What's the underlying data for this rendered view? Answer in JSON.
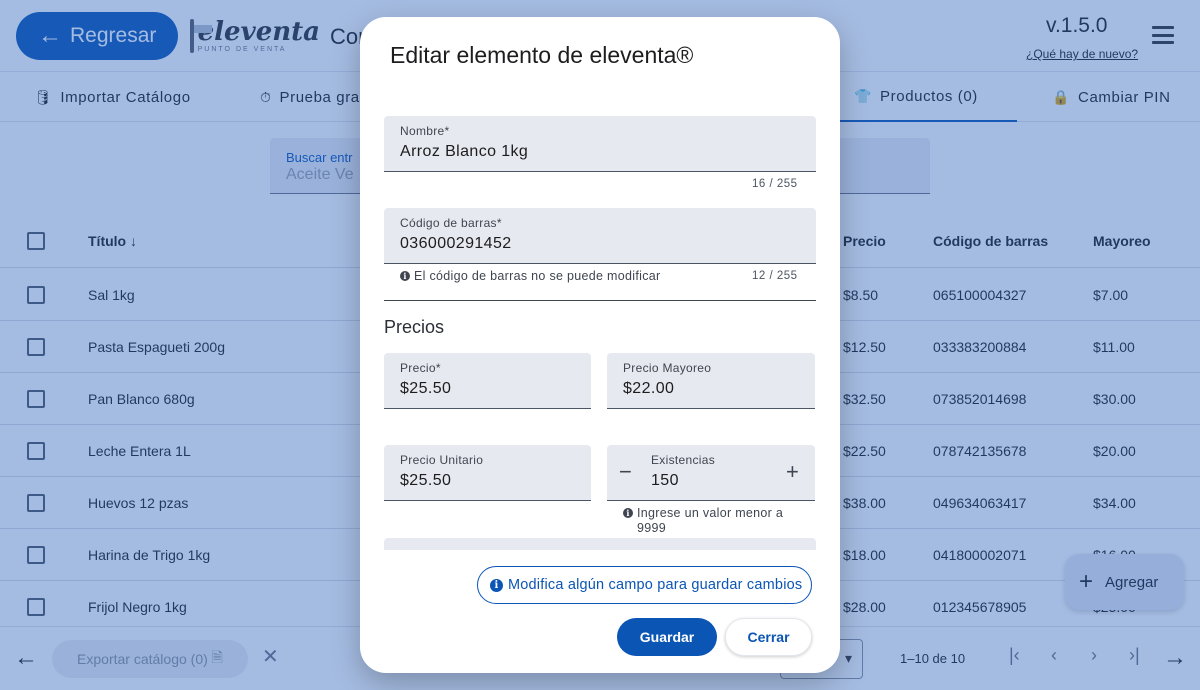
{
  "header": {
    "back_label": "Regresar",
    "logo_text": "eleventa",
    "logo_sub": "PUNTO DE VENTA",
    "title_partial": "Con",
    "version": "v.1.5.0",
    "whats_new": "¿Qué hay de nuevo?"
  },
  "tabs": [
    {
      "label": "Importar Catálogo",
      "icon": "database-icon"
    },
    {
      "label": "Prueba gra",
      "icon": "stopwatch-icon"
    },
    {
      "label": "Productos (0)",
      "icon": "shirt-icon"
    },
    {
      "label": "Cambiar PIN",
      "icon": "lock-icon"
    }
  ],
  "search": {
    "label": "Buscar entr",
    "placeholder": "Aceite Ve"
  },
  "table": {
    "columns": {
      "title": "Título",
      "price": "Precio",
      "barcode": "Código de barras",
      "wholesale": "Mayoreo"
    },
    "rows": [
      {
        "title": "Sal 1kg",
        "price": "$8.50",
        "barcode": "065100004327",
        "wholesale": "$7.00"
      },
      {
        "title": "Pasta Espagueti 200g",
        "price": "$12.50",
        "barcode": "033383200884",
        "wholesale": "$11.00"
      },
      {
        "title": "Pan Blanco 680g",
        "price": "$32.50",
        "barcode": "073852014698",
        "wholesale": "$30.00"
      },
      {
        "title": "Leche Entera 1L",
        "price": "$22.50",
        "barcode": "078742135678",
        "wholesale": "$20.00"
      },
      {
        "title": "Huevos 12 pzas",
        "price": "$38.00",
        "barcode": "049634063417",
        "wholesale": "$34.00"
      },
      {
        "title": "Harina de Trigo 1kg",
        "price": "$18.00",
        "barcode": "041800002071",
        "wholesale": "$16.00"
      },
      {
        "title": "Frijol Negro 1kg",
        "price": "$28.00",
        "barcode": "012345678905",
        "wholesale": "$25.00"
      }
    ]
  },
  "fab": {
    "label": "Agregar"
  },
  "footer": {
    "export_label": "Exportar catálogo (0)",
    "pager_info": "1–10 de 10"
  },
  "dialog": {
    "title": "Editar elemento de eleventa®",
    "name": {
      "label": "Nombre*",
      "value": "Arroz Blanco 1kg",
      "counter": "16 / 255"
    },
    "barcode": {
      "label": "Código de barras*",
      "value": "036000291452",
      "hint": "El código de barras no se puede modificar",
      "counter": "12 / 255"
    },
    "prices_title": "Precios",
    "price": {
      "label": "Precio*",
      "value": "$25.50"
    },
    "wholesale_price": {
      "label": "Precio Mayoreo",
      "value": "$22.00"
    },
    "unit_price": {
      "label": "Precio Unitario",
      "value": "$25.50"
    },
    "stock": {
      "label": "Existencias",
      "value": "150",
      "hint": "Ingrese un valor menor a 9999"
    },
    "notice": "Modifica algún campo para guardar cambios",
    "save_label": "Guardar",
    "close_label": "Cerrar"
  },
  "colors": {
    "primary": "#0b55b5",
    "scrim": "rgba(40, 95, 185, 0.42)",
    "field_bg": "#e7e9f0"
  }
}
